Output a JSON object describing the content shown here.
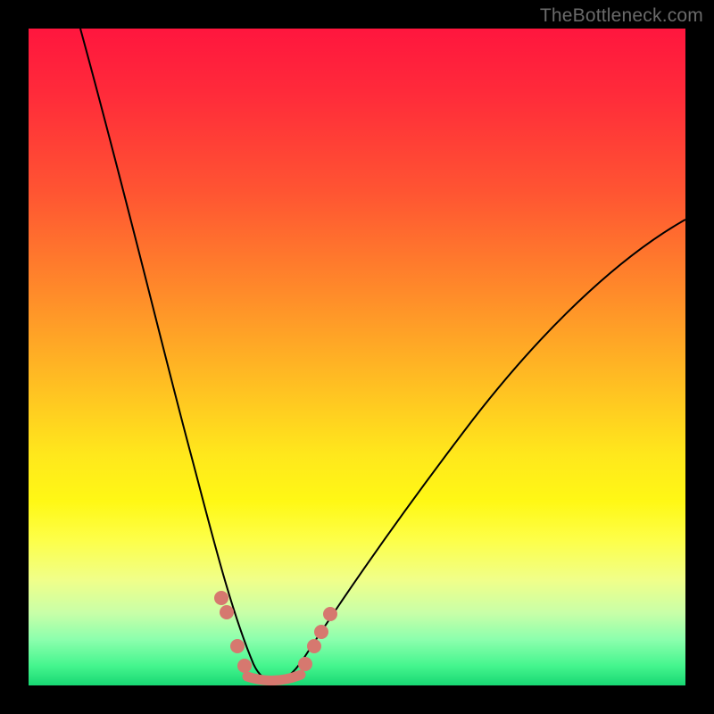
{
  "watermark": "TheBottleneck.com",
  "colors": {
    "frame": "#000000",
    "curve": "#000000",
    "dots": "#d6786f",
    "gradient_stops": [
      {
        "pct": 0,
        "hex": "#ff163e"
      },
      {
        "pct": 10,
        "hex": "#ff2b3a"
      },
      {
        "pct": 25,
        "hex": "#ff5532"
      },
      {
        "pct": 40,
        "hex": "#ff8a2a"
      },
      {
        "pct": 55,
        "hex": "#ffc222"
      },
      {
        "pct": 65,
        "hex": "#ffe81c"
      },
      {
        "pct": 72,
        "hex": "#fff815"
      },
      {
        "pct": 78,
        "hex": "#fdff4a"
      },
      {
        "pct": 84,
        "hex": "#f0ff8a"
      },
      {
        "pct": 89,
        "hex": "#c8ffa8"
      },
      {
        "pct": 93,
        "hex": "#8cffad"
      },
      {
        "pct": 97,
        "hex": "#45f58e"
      },
      {
        "pct": 100,
        "hex": "#18d873"
      }
    ]
  },
  "chart_data": {
    "type": "line",
    "title": "",
    "xlabel": "",
    "ylabel": "",
    "ylim": [
      0,
      100
    ],
    "xlim": [
      0,
      100
    ],
    "series": [
      {
        "name": "bottleneck-curve",
        "x": [
          8,
          12,
          16,
          20,
          24,
          27,
          29,
          31,
          33,
          35,
          37,
          39,
          42,
          46,
          52,
          58,
          66,
          76,
          88,
          100
        ],
        "values": [
          100,
          82,
          66,
          52,
          39,
          28,
          20,
          12,
          6,
          3,
          2,
          3,
          6,
          12,
          22,
          32,
          43,
          54,
          63,
          70
        ]
      }
    ],
    "markers": {
      "name": "highlighted-points",
      "x": [
        29,
        30.5,
        33,
        35,
        37,
        40,
        42,
        43.5,
        45
      ],
      "values": [
        20,
        14,
        7,
        3,
        2,
        3,
        7,
        12,
        16
      ]
    },
    "annotations": [
      {
        "text": "TheBottleneck.com",
        "pos": "top-right"
      }
    ]
  }
}
